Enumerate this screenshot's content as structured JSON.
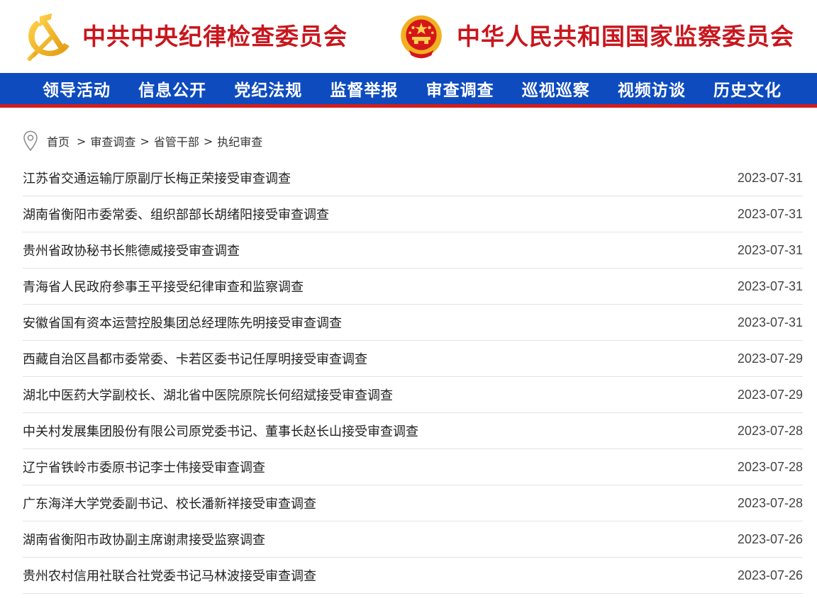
{
  "header": {
    "left_title": "中共中央纪律检查委员会",
    "right_title": "中华人民共和国国家监察委员会",
    "left_emblem_icon": "party-emblem-icon",
    "right_emblem_icon": "national-emblem-icon"
  },
  "nav": {
    "items": [
      "领导活动",
      "信息公开",
      "党纪法规",
      "监督举报",
      "审查调查",
      "巡视巡察",
      "视频访谈",
      "历史文化"
    ]
  },
  "breadcrumb": {
    "icon": "location-pin-icon",
    "items": [
      "首页",
      "审查调查",
      "省管干部",
      "执纪审查"
    ],
    "separator": ">"
  },
  "articles": [
    {
      "title": "江苏省交通运输厅原副厅长梅正荣接受审查调查",
      "date": "2023-07-31"
    },
    {
      "title": "湖南省衡阳市委常委、组织部部长胡绪阳接受审查调查",
      "date": "2023-07-31"
    },
    {
      "title": "贵州省政协秘书长熊德威接受审查调查",
      "date": "2023-07-31"
    },
    {
      "title": "青海省人民政府参事王平接受纪律审查和监察调查",
      "date": "2023-07-31"
    },
    {
      "title": "安徽省国有资本运营控股集团总经理陈先明接受审查调查",
      "date": "2023-07-31"
    },
    {
      "title": "西藏自治区昌都市委常委、卡若区委书记任厚明接受审查调查",
      "date": "2023-07-29"
    },
    {
      "title": "湖北中医药大学副校长、湖北省中医院原院长何绍斌接受审查调查",
      "date": "2023-07-29"
    },
    {
      "title": "中关村发展集团股份有限公司原党委书记、董事长赵长山接受审查调查",
      "date": "2023-07-28"
    },
    {
      "title": "辽宁省铁岭市委原书记李士伟接受审查调查",
      "date": "2023-07-28"
    },
    {
      "title": "广东海洋大学党委副书记、校长潘新祥接受审查调查",
      "date": "2023-07-28"
    },
    {
      "title": "湖南省衡阳市政协副主席谢肃接受监察调查",
      "date": "2023-07-26"
    },
    {
      "title": "贵州农村信用社联合社党委书记马林波接受审查调查",
      "date": "2023-07-26"
    }
  ],
  "colors": {
    "brand_red": "#c8161d",
    "nav_blue": "#0d4bbf",
    "nav_border_red": "#d51c1c",
    "emblem_gold": "#f2b020"
  }
}
